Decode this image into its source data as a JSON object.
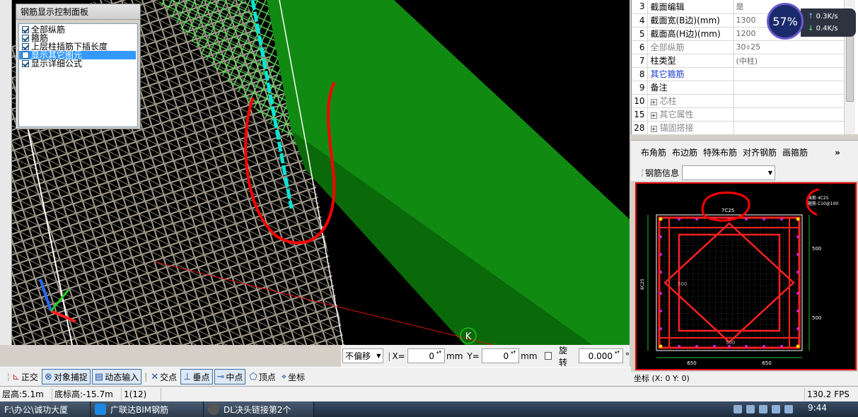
{
  "control_panel": {
    "title": "钢筋显示控制面板",
    "items": [
      {
        "label": "全部纵筋",
        "checked": true,
        "selected": false
      },
      {
        "label": "箍筋",
        "checked": true,
        "selected": false
      },
      {
        "label": "上层柱插筋下插长度",
        "checked": true,
        "selected": false
      },
      {
        "label": "显示其它图元",
        "checked": false,
        "selected": true
      },
      {
        "label": "显示详细公式",
        "checked": true,
        "selected": false
      }
    ]
  },
  "viewport": {
    "nav_marker": "K"
  },
  "offset_bar": {
    "offset_mode": "不偏移",
    "x_label": "X=",
    "x_value": "0",
    "x_unit": "mm",
    "y_label": "Y=",
    "y_value": "0",
    "y_unit": "mm",
    "rotate_label": "旋转",
    "rotate_value": "0.000",
    "rotate_unit": "°"
  },
  "snap_bar": {
    "ortho": "正交",
    "object_snap": "对象捕捉",
    "dynamic_input": "动态输入",
    "intersection": "交点",
    "perpendicular": "垂点",
    "midpoint": "中点",
    "vertex": "顶点",
    "coordinate": "坐标"
  },
  "status_bar": {
    "floor_height": "层高:5.1m",
    "base_elevation": "底标高:-15.7m",
    "count": "1(12)",
    "fps": "130.2 FPS"
  },
  "properties": {
    "rows": [
      {
        "num": "3",
        "name": "截面编辑",
        "value": "是",
        "style": "normal",
        "expand": false
      },
      {
        "num": "4",
        "name": "截面宽(B边)(mm)",
        "value": "1300",
        "style": "normal",
        "expand": false
      },
      {
        "num": "5",
        "name": "截面高(H边)(mm)",
        "value": "1200",
        "style": "normal",
        "expand": false
      },
      {
        "num": "6",
        "name": "全部纵筋",
        "value": "30⌽25",
        "style": "gray",
        "expand": false
      },
      {
        "num": "7",
        "name": "柱类型",
        "value": "(中柱)",
        "style": "normal",
        "expand": false
      },
      {
        "num": "8",
        "name": "其它箍筋",
        "value": "",
        "style": "blue",
        "expand": false
      },
      {
        "num": "9",
        "name": "备注",
        "value": "",
        "style": "normal",
        "expand": false
      },
      {
        "num": "10",
        "name": "芯柱",
        "value": "",
        "style": "gray",
        "expand": true
      },
      {
        "num": "15",
        "name": "其它属性",
        "value": "",
        "style": "gray",
        "expand": true
      },
      {
        "num": "28",
        "name": "锚固搭接",
        "value": "",
        "style": "gray",
        "expand": true
      }
    ]
  },
  "section_editor": {
    "tools": [
      "布角筋",
      "布边筋",
      "特殊布筋",
      "对齐钢筋",
      "画箍筋"
    ],
    "more": "»",
    "info_label": "钢筋信息",
    "top_label": "7C25",
    "legend_label_1": "角筋 4C25",
    "legend_label_2": "箍筋 C10@100",
    "left_label": "8C25",
    "dim_right_top": "500",
    "dim_right_bottom": "500",
    "dim_bottom_left": "650",
    "dim_bottom_right": "650",
    "inner_dim_1": "500",
    "inner_dim_2": "500",
    "coord_text": "坐标 (X: 0 Y: 0)"
  },
  "speed_widget": {
    "percent": "57%",
    "up_rate": "0.3K/s",
    "down_rate": "0.4K/s"
  },
  "taskbar": {
    "items": [
      "F:\\办公\\诚功大厦",
      "广联达BIM钢筋",
      "DL决头链接第2个"
    ],
    "clock": "9:44"
  },
  "colors": {
    "green_beam": "#1a8a1a",
    "cage": "#a09a8c",
    "annotation": "#e00000",
    "selected_bar": "#00e0d0"
  }
}
